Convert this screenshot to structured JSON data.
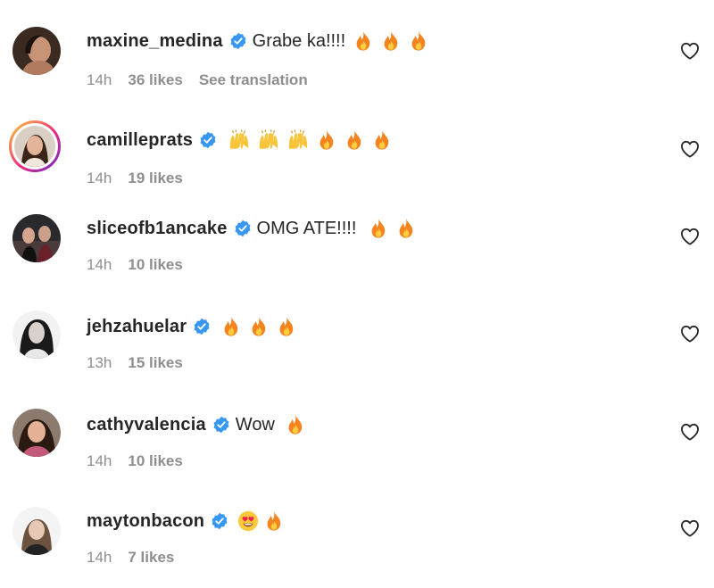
{
  "comments": [
    {
      "username": "maxine_medina",
      "text": "Grabe ka!!!!",
      "emojis": [
        "fire",
        "fire",
        "fire"
      ],
      "time": "14h",
      "likes": "36 likes",
      "translation_link": "See translation"
    },
    {
      "username": "camilleprats",
      "text": "",
      "emojis": [
        "raising-hands",
        "raising-hands",
        "raising-hands",
        "fire",
        "fire",
        "fire"
      ],
      "time": "14h",
      "likes": "19 likes"
    },
    {
      "username": "sliceofb1ancake",
      "text": "OMG ATE!!!!",
      "emojis": [
        "fire",
        "fire"
      ],
      "time": "14h",
      "likes": "10 likes"
    },
    {
      "username": "jehzahuelar",
      "text": "",
      "emojis": [
        "fire",
        "fire",
        "fire"
      ],
      "time": "13h",
      "likes": "15 likes"
    },
    {
      "username": "cathyvalencia",
      "text": "Wow",
      "emojis": [
        "fire"
      ],
      "time": "14h",
      "likes": "10 likes"
    },
    {
      "username": "maytonbacon",
      "text": "",
      "emojis": [
        "heart-eyes",
        "fire"
      ],
      "time": "14h",
      "likes": "7 likes"
    }
  ],
  "icons": {
    "verified": "verified-badge-icon",
    "like": "heart-outline-icon",
    "fire": "fire-emoji-icon",
    "raising_hands": "raising-hands-emoji-icon",
    "heart_eyes": "heart-eyes-emoji-icon"
  },
  "colors": {
    "username": "#262626",
    "meta": "#8e8e8e",
    "verified": "#3897f0",
    "fire": "#f5831f"
  }
}
